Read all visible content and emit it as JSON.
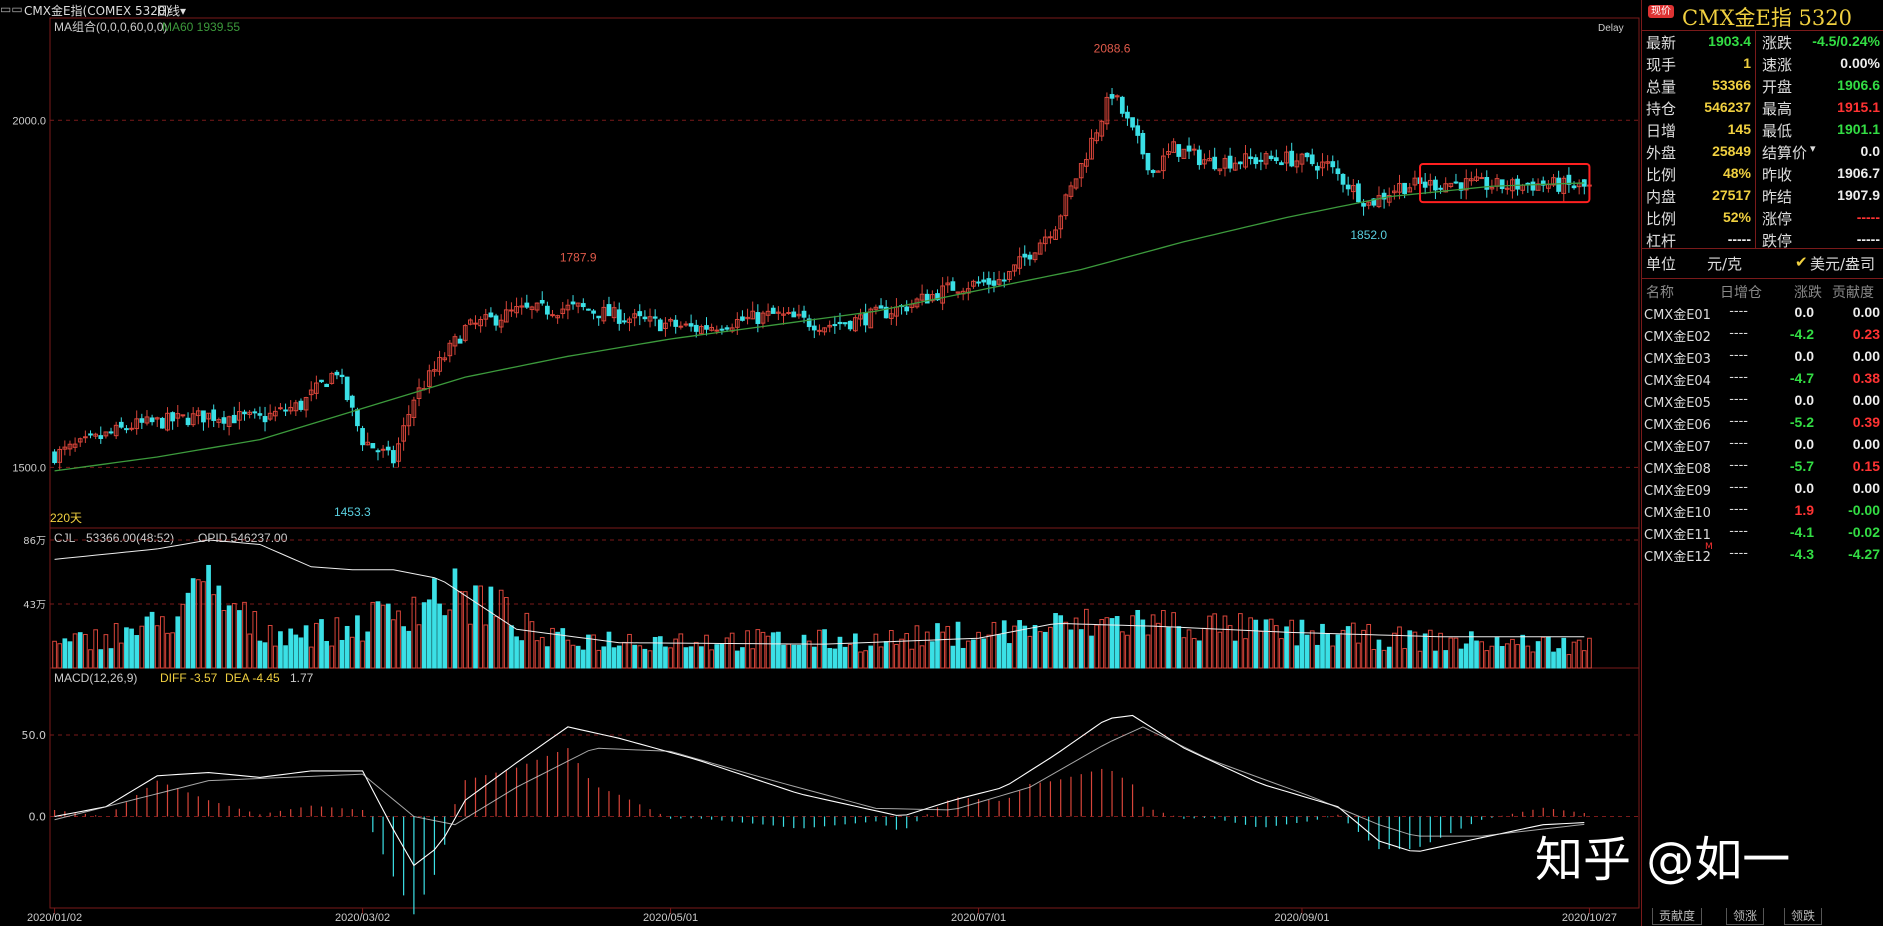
{
  "header": {
    "symbol": "CMX金E指(COMEX 5320)",
    "period": "日线",
    "period_arrow": "▾",
    "delay": "Delay",
    "ma_label": "MA组合(0,0,0,60,0,0)",
    "ma60_label": "MA60 1939.55",
    "days_label": "220天",
    "vol_label": "CJL",
    "vol_value": "53366.00(48:52)",
    "opid_value": "OPID 546237.00",
    "macd_label": "MACD(12,26,9)",
    "diff_value": "DIFF -3.57",
    "dea_value": "DEA -4.45",
    "macd_value": "1.77"
  },
  "colors": {
    "up": "#d8453a",
    "down": "#3be0e6",
    "ma": "#3c9a3c",
    "grid": "#7a1a1a",
    "panel_title": "#f0d040"
  },
  "chart_data": [
    {
      "type": "candlestick",
      "x_ticks": [
        "2020/01/02",
        "2020/03/02",
        "2020/05/01",
        "2020/07/01",
        "2020/09/01",
        "2020/10/27"
      ],
      "x_tick_days": [
        0,
        60,
        120,
        180,
        243,
        299
      ],
      "y_ticks": [
        1500,
        2000
      ],
      "y_tick_labels": [
        "1500.0",
        "2000.0"
      ],
      "ylim": [
        1430,
        2130
      ],
      "annotations": [
        {
          "text": "2088.6",
          "day": 206,
          "value": 2088.6,
          "kind": "high"
        },
        {
          "text": "1787.9",
          "day": 102,
          "value": 1787.9,
          "kind": "high"
        },
        {
          "text": "1453.3",
          "day": 58,
          "value": 1453.3,
          "kind": "low"
        },
        {
          "text": "1852.0",
          "day": 256,
          "value": 1852.0,
          "kind": "low"
        }
      ],
      "close_anchors": [
        [
          0,
          1518
        ],
        [
          15,
          1560
        ],
        [
          30,
          1575
        ],
        [
          40,
          1570
        ],
        [
          48,
          1590
        ],
        [
          55,
          1640
        ],
        [
          60,
          1540
        ],
        [
          66,
          1510
        ],
        [
          70,
          1600
        ],
        [
          80,
          1700
        ],
        [
          90,
          1725
        ],
        [
          102,
          1730
        ],
        [
          115,
          1710
        ],
        [
          125,
          1700
        ],
        [
          140,
          1720
        ],
        [
          150,
          1705
        ],
        [
          155,
          1710
        ],
        [
          165,
          1730
        ],
        [
          175,
          1760
        ],
        [
          185,
          1770
        ],
        [
          195,
          1850
        ],
        [
          200,
          1935
        ],
        [
          206,
          2040
        ],
        [
          214,
          1925
        ],
        [
          218,
          1960
        ],
        [
          225,
          1940
        ],
        [
          240,
          1945
        ],
        [
          248,
          1935
        ],
        [
          256,
          1880
        ],
        [
          262,
          1905
        ],
        [
          272,
          1910
        ],
        [
          282,
          1905
        ],
        [
          290,
          1908
        ],
        [
          299,
          1903
        ]
      ],
      "ma60": [
        [
          0,
          1495
        ],
        [
          20,
          1515
        ],
        [
          40,
          1540
        ],
        [
          60,
          1585
        ],
        [
          80,
          1630
        ],
        [
          100,
          1660
        ],
        [
          120,
          1685
        ],
        [
          140,
          1705
        ],
        [
          160,
          1725
        ],
        [
          180,
          1755
        ],
        [
          200,
          1785
        ],
        [
          220,
          1825
        ],
        [
          240,
          1860
        ],
        [
          260,
          1890
        ],
        [
          280,
          1905
        ],
        [
          299,
          1910
        ]
      ],
      "highlight_box": {
        "day_start": 266,
        "day_end": 299,
        "low": 1882,
        "high": 1937
      }
    },
    {
      "type": "bar",
      "name": "CJL",
      "ylim": [
        0,
        860000
      ],
      "y_tick_labels": [
        "86万",
        "43万"
      ],
      "y_ticks": [
        860000,
        430000
      ],
      "levels": [
        [
          0,
          150000
        ],
        [
          20,
          300000
        ],
        [
          30,
          550000
        ],
        [
          40,
          260000
        ],
        [
          55,
          250000
        ],
        [
          65,
          380000
        ],
        [
          75,
          520000
        ],
        [
          85,
          450000
        ],
        [
          95,
          200000
        ],
        [
          120,
          200000
        ],
        [
          160,
          190000
        ],
        [
          195,
          290000
        ],
        [
          210,
          330000
        ],
        [
          240,
          250000
        ],
        [
          270,
          190000
        ],
        [
          299,
          160000
        ]
      ],
      "oi_line": [
        [
          0,
          730000
        ],
        [
          20,
          800000
        ],
        [
          30,
          860000
        ],
        [
          40,
          830000
        ],
        [
          50,
          680000
        ],
        [
          58,
          660000
        ],
        [
          66,
          660000
        ],
        [
          75,
          600000
        ],
        [
          90,
          260000
        ],
        [
          110,
          170000
        ],
        [
          150,
          160000
        ],
        [
          180,
          200000
        ],
        [
          195,
          300000
        ],
        [
          215,
          280000
        ],
        [
          240,
          240000
        ],
        [
          270,
          210000
        ],
        [
          299,
          210000
        ]
      ]
    },
    {
      "type": "macd",
      "name": "MACD",
      "ylim": [
        -50,
        85
      ],
      "y_ticks": [
        0,
        50
      ],
      "y_tick_labels": [
        "0.0",
        "50.0"
      ],
      "diff": [
        [
          0,
          0
        ],
        [
          10,
          6
        ],
        [
          20,
          25
        ],
        [
          30,
          27
        ],
        [
          40,
          24
        ],
        [
          50,
          28
        ],
        [
          60,
          28
        ],
        [
          66,
          -8
        ],
        [
          70,
          -30
        ],
        [
          75,
          -18
        ],
        [
          80,
          10
        ],
        [
          90,
          33
        ],
        [
          100,
          55
        ],
        [
          110,
          48
        ],
        [
          125,
          35
        ],
        [
          145,
          14
        ],
        [
          165,
          0
        ],
        [
          175,
          10
        ],
        [
          185,
          18
        ],
        [
          195,
          38
        ],
        [
          205,
          60
        ],
        [
          210,
          62
        ],
        [
          220,
          42
        ],
        [
          235,
          20
        ],
        [
          250,
          6
        ],
        [
          258,
          -15
        ],
        [
          265,
          -22
        ],
        [
          275,
          -15
        ],
        [
          290,
          -5
        ],
        [
          299,
          -3.57
        ]
      ],
      "dea": [
        [
          0,
          -2
        ],
        [
          15,
          10
        ],
        [
          30,
          22
        ],
        [
          45,
          24
        ],
        [
          60,
          26
        ],
        [
          70,
          0
        ],
        [
          78,
          -5
        ],
        [
          90,
          18
        ],
        [
          105,
          42
        ],
        [
          120,
          40
        ],
        [
          140,
          22
        ],
        [
          160,
          5
        ],
        [
          175,
          4
        ],
        [
          190,
          18
        ],
        [
          205,
          45
        ],
        [
          212,
          55
        ],
        [
          225,
          35
        ],
        [
          245,
          12
        ],
        [
          258,
          -5
        ],
        [
          265,
          -12
        ],
        [
          278,
          -12
        ],
        [
          299,
          -4.45
        ]
      ]
    }
  ],
  "quote": {
    "badge": "现价",
    "title": "CMX金E指  5320",
    "left": [
      {
        "label": "最新",
        "value": "1903.4",
        "color": "g"
      },
      {
        "label": "现手",
        "value": "1",
        "color": "y"
      },
      {
        "label": "总量",
        "value": "53366",
        "color": "y"
      },
      {
        "label": "持仓",
        "value": "546237",
        "color": "y"
      },
      {
        "label": "日增",
        "value": "145",
        "color": "y"
      },
      {
        "label": "外盘",
        "value": "25849",
        "color": "y"
      },
      {
        "label": "比例",
        "value": "48%",
        "color": "y"
      },
      {
        "label": "内盘",
        "value": "27517",
        "color": "y"
      },
      {
        "label": "比例",
        "value": "52%",
        "color": "y"
      },
      {
        "label": "杠杆",
        "value": "-----",
        "color": "w"
      }
    ],
    "right": [
      {
        "label": "涨跌",
        "value": "-4.5/0.24%",
        "color": "g"
      },
      {
        "label": "速涨",
        "value": "0.00%",
        "color": "w"
      },
      {
        "label": "开盘",
        "value": "1906.6",
        "color": "g"
      },
      {
        "label": "最高",
        "value": "1915.1",
        "color": "r"
      },
      {
        "label": "最低",
        "value": "1901.1",
        "color": "g"
      },
      {
        "label": "结算价",
        "value": "0.0",
        "color": "w"
      },
      {
        "label": "昨收",
        "value": "1906.7",
        "color": "w"
      },
      {
        "label": "昨结",
        "value": "1907.9",
        "color": "w"
      },
      {
        "label": "涨停",
        "value": "-----",
        "color": "r"
      },
      {
        "label": "跌停",
        "value": "-----",
        "color": "w"
      }
    ],
    "settle_arrow": "▾",
    "unit_label": "单位",
    "unit_rmb": "元/克",
    "unit_check": "✔",
    "unit_usd": "美元/盎司"
  },
  "contracts": {
    "headers": [
      "名称",
      "日增仓",
      "涨跌",
      "贡献度"
    ],
    "rows": [
      {
        "name": "CMX金E01",
        "inc": "----",
        "chg": "0.0",
        "contrib": "0.00",
        "cc": "w",
        "tc": "w",
        "m": ""
      },
      {
        "name": "CMX金E02",
        "inc": "----",
        "chg": "-4.2",
        "contrib": "0.23",
        "cc": "g",
        "tc": "r",
        "m": ""
      },
      {
        "name": "CMX金E03",
        "inc": "----",
        "chg": "0.0",
        "contrib": "0.00",
        "cc": "w",
        "tc": "w",
        "m": ""
      },
      {
        "name": "CMX金E04",
        "inc": "----",
        "chg": "-4.7",
        "contrib": "0.38",
        "cc": "g",
        "tc": "r",
        "m": ""
      },
      {
        "name": "CMX金E05",
        "inc": "----",
        "chg": "0.0",
        "contrib": "0.00",
        "cc": "w",
        "tc": "w",
        "m": ""
      },
      {
        "name": "CMX金E06",
        "inc": "----",
        "chg": "-5.2",
        "contrib": "0.39",
        "cc": "g",
        "tc": "r",
        "m": ""
      },
      {
        "name": "CMX金E07",
        "inc": "----",
        "chg": "0.0",
        "contrib": "0.00",
        "cc": "w",
        "tc": "w",
        "m": ""
      },
      {
        "name": "CMX金E08",
        "inc": "----",
        "chg": "-5.7",
        "contrib": "0.15",
        "cc": "g",
        "tc": "r",
        "m": ""
      },
      {
        "name": "CMX金E09",
        "inc": "----",
        "chg": "0.0",
        "contrib": "0.00",
        "cc": "w",
        "tc": "w",
        "m": ""
      },
      {
        "name": "CMX金E10",
        "inc": "----",
        "chg": "1.9",
        "contrib": "-0.00",
        "cc": "r",
        "tc": "g",
        "m": ""
      },
      {
        "name": "CMX金E11",
        "inc": "----",
        "chg": "-4.1",
        "contrib": "-0.02",
        "cc": "g",
        "tc": "g",
        "m": ""
      },
      {
        "name": "CMX金E12",
        "inc": "----",
        "chg": "-4.3",
        "contrib": "-4.27",
        "cc": "g",
        "tc": "g",
        "m": "M"
      }
    ]
  },
  "tabs": [
    "贡献度",
    "领涨",
    "领跌"
  ],
  "watermark": "知乎 @如一"
}
